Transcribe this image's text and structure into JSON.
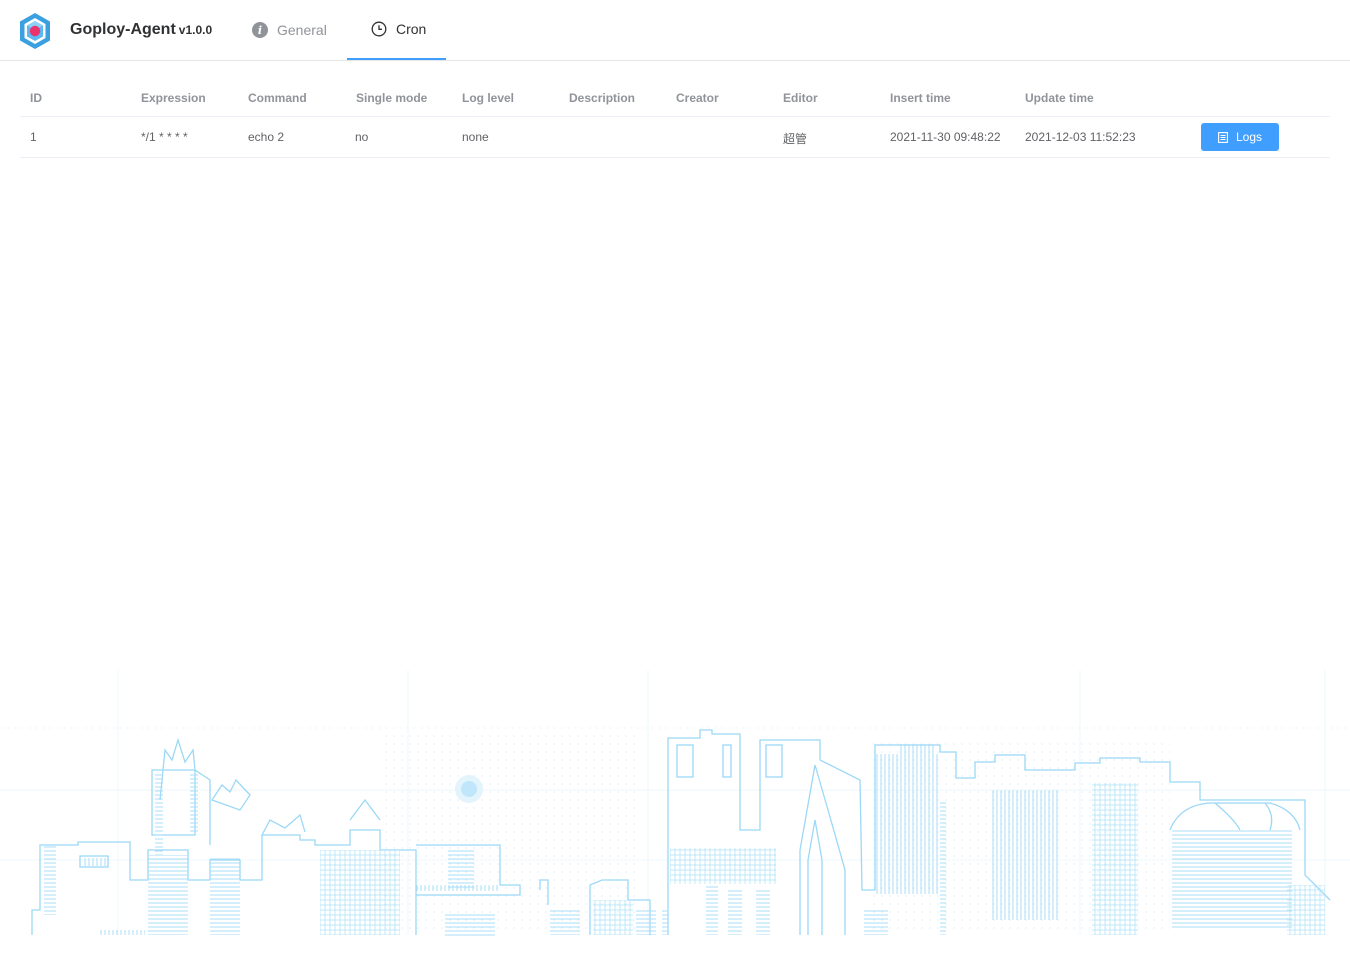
{
  "header": {
    "app_name": "Goploy-Agent",
    "version": "v1.0.0",
    "logo_icon": "goploy-hexagon-logo"
  },
  "tabs": [
    {
      "label": "General",
      "icon": "info-icon",
      "active": false
    },
    {
      "label": "Cron",
      "icon": "clock-icon",
      "active": true
    }
  ],
  "table": {
    "columns": [
      "ID",
      "Expression",
      "Command",
      "Single mode",
      "Log level",
      "Description",
      "Creator",
      "Editor",
      "Insert time",
      "Update time"
    ],
    "rows": [
      {
        "id": "1",
        "expression": "*/1 * * * *",
        "command": "echo 2",
        "single_mode": "no",
        "log_level": "none",
        "description": "",
        "creator": "",
        "editor": "超管",
        "insert_time": "2021-11-30 09:48:22",
        "update_time": "2021-12-03 11:52:23",
        "action_label": "Logs",
        "action_icon": "document-icon"
      }
    ]
  },
  "colors": {
    "primary": "#409eff",
    "skyline": "#9bd8f7",
    "border": "#ebeef5"
  }
}
